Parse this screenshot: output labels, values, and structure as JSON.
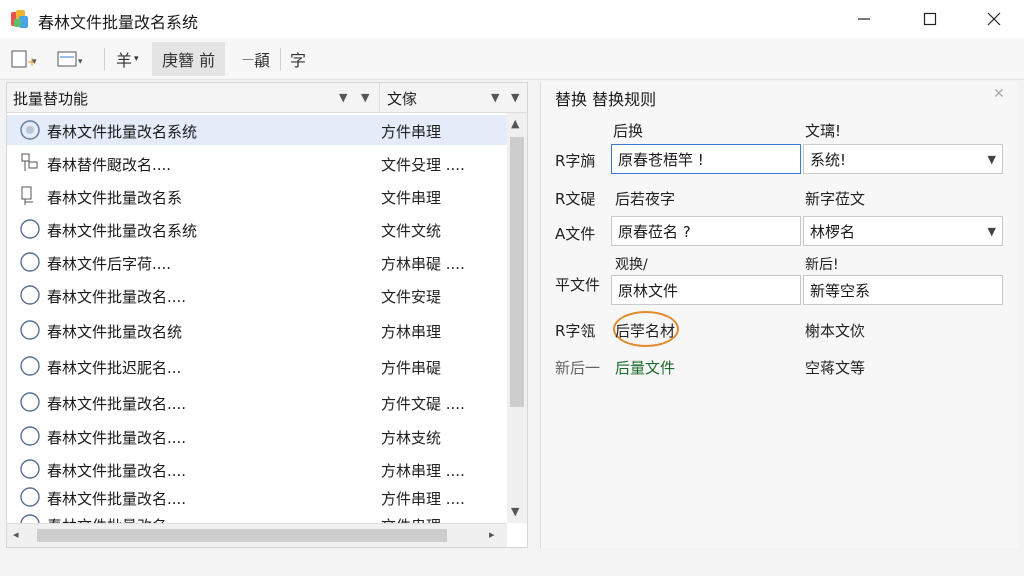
{
  "window": {
    "title": "春林文件批量改名系统",
    "icons": {
      "app": "app-icon",
      "minimize": "minimize-icon",
      "maximize": "maximize-icon",
      "close": "close-icon"
    }
  },
  "toolbar": {
    "item3_label": "羊",
    "item4_label": "庚簪 前",
    "item5_label": "䫇",
    "item6_label": "字"
  },
  "file_list": {
    "col_name": "批量替功能",
    "col_type": "文傢",
    "rows": [
      {
        "name": "春林文件批量改名系统",
        "type": "方件串理",
        "icon": "disc-icon",
        "selected": true
      },
      {
        "name": "春林替件颬改名....",
        "type": "文件殳理 ....",
        "icon": "tree-icon"
      },
      {
        "name": "春林文件批量改名系",
        "type": "文件串理",
        "icon": "tree-icon"
      },
      {
        "name": "春林文件批量改名系统",
        "type": "文件文统",
        "icon": "circle-icon"
      },
      {
        "name": "春林文件后字荷....",
        "type": "方林串碮 ....",
        "icon": "circle-icon"
      },
      {
        "name": "春林文件批量改名....",
        "type": "文件安瑅",
        "icon": "circle-icon"
      },
      {
        "name": "春林文件批量改名统",
        "type": "方林串理",
        "icon": "circle-icon"
      },
      {
        "name": "春林文件批迟胒名...",
        "type": "方件串碮",
        "icon": "circle-icon"
      },
      {
        "name": "春林文件批量改名....",
        "type": "方件文碮 ....",
        "icon": "circle-icon"
      },
      {
        "name": "春林文件批量改名....",
        "type": "方林支统",
        "icon": "circle-icon"
      },
      {
        "name": "春林文件批量改名....",
        "type": "方林串理 ....",
        "icon": "circle-icon"
      },
      {
        "name": "春林文件批量改名....",
        "type": "方件串理 ....",
        "icon": "circle-icon"
      },
      {
        "name": "春林文件批量改名....",
        "type": "文件串理 ....",
        "icon": "circle-icon"
      }
    ]
  },
  "right_panel": {
    "title": "替换  替换规则",
    "col1": "后换",
    "col2": "文璃!",
    "rows": [
      {
        "label": "R字旓",
        "field1": "原春苍梧竿 !",
        "field2": "系统!",
        "dropdown": true
      },
      {
        "label": "R文碮",
        "text1": "后若夜字",
        "text2": "新字莅文"
      },
      {
        "label": "A文件",
        "field1": "原春莅名 ?",
        "field2": "林椤名",
        "dropdown": true
      },
      {
        "label": "平文件",
        "sub1": "观换/",
        "sub2": "新后!",
        "field1": "原林文件",
        "field2": "新等空系"
      },
      {
        "label": "R字瓴",
        "text1": "后荢名材",
        "text2": "榭本文佽"
      },
      {
        "label": "新后一",
        "text1": "后量文件",
        "text2": "空蒋文等"
      }
    ]
  },
  "colors": {
    "accent_border": "#3a78d8",
    "highlight_circle": "#e08a2c",
    "green_text": "#1b6a2d",
    "selection": "#e3ecf8"
  }
}
